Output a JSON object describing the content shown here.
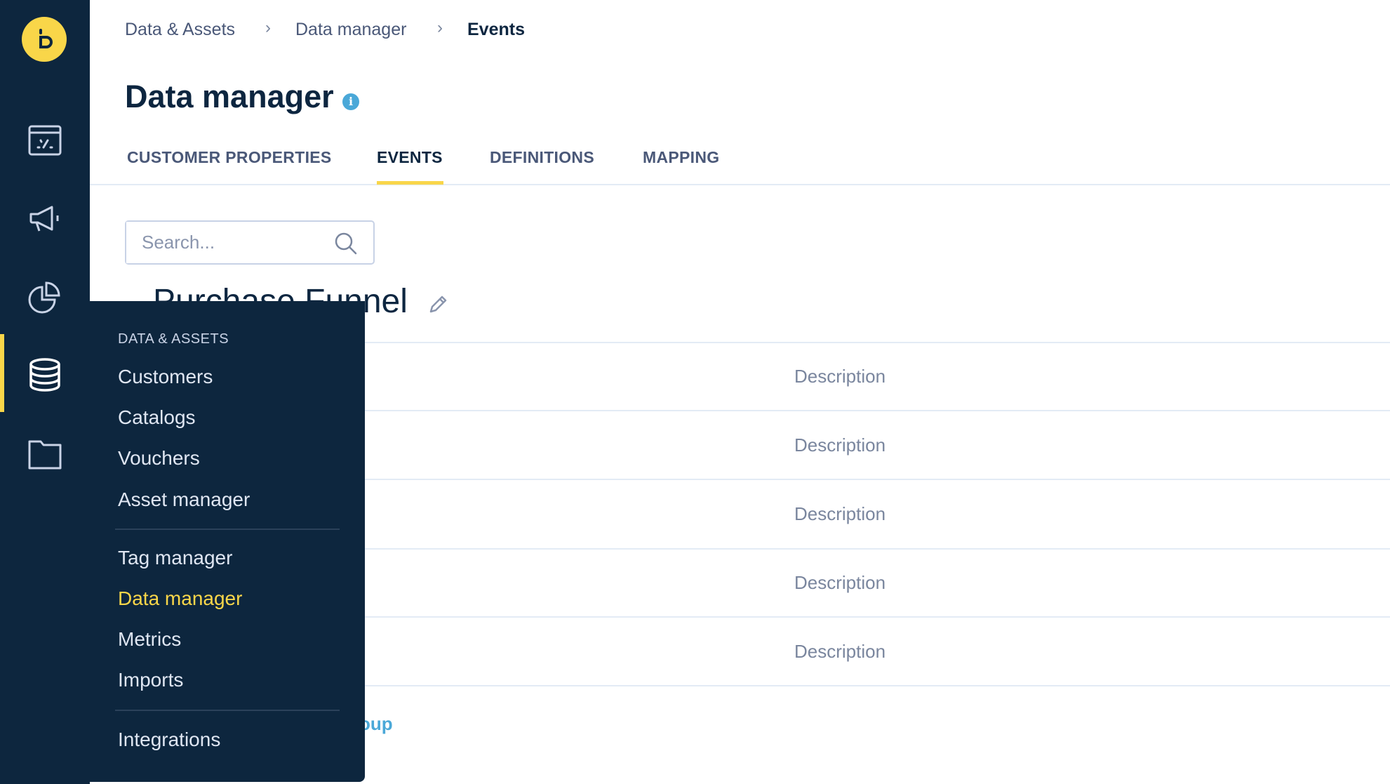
{
  "colors": {
    "sidebar": "#0d263e",
    "accent": "#f9d649",
    "info": "#4aa8d8",
    "text": "#0d2640"
  },
  "sidebar": {
    "icons": [
      "logo-icon",
      "dashboard-icon",
      "megaphone-icon",
      "pie-chart-icon",
      "database-icon",
      "folder-icon"
    ],
    "active": "database-icon"
  },
  "breadcrumb": [
    "Data & Assets",
    "Data manager",
    "Events"
  ],
  "page_title": "Data manager",
  "info_glyph": "i",
  "tabs": [
    {
      "label": "CUSTOMER PROPERTIES"
    },
    {
      "label": "EVENTS",
      "active": true
    },
    {
      "label": "DEFINITIONS"
    },
    {
      "label": "MAPPING"
    }
  ],
  "search": {
    "placeholder": "Search...",
    "value": ""
  },
  "group": {
    "title": "Purchase Funnel",
    "rows": [
      {
        "description": "Description"
      },
      {
        "description": "Description"
      },
      {
        "description": "Description"
      },
      {
        "description": "Description"
      },
      {
        "description": "Description"
      }
    ],
    "link_partial": "oup"
  },
  "menu": {
    "header": "DATA & ASSETS",
    "items": [
      "Customers",
      "Catalogs",
      "Vouchers",
      "Asset manager",
      "Tag manager",
      "Data manager",
      "Metrics",
      "Imports",
      "Integrations"
    ],
    "selected": "Data manager"
  }
}
